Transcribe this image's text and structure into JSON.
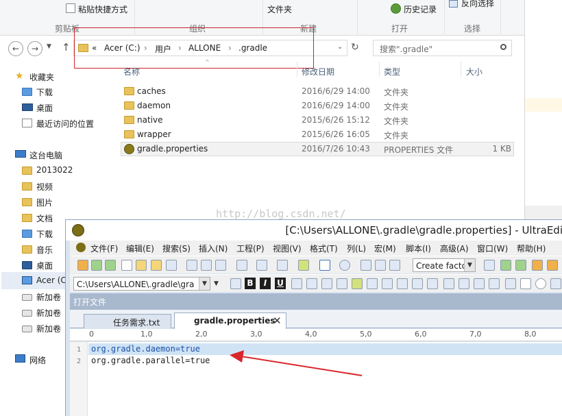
{
  "ribbon": {
    "top_items": {
      "paste_shortcut": "粘贴快捷方式",
      "file_folder": "文件夹",
      "history": "历史记录",
      "reverse_select": "反向选择"
    },
    "groups": [
      "剪贴板",
      "组织",
      "新建",
      "打开",
      "选择"
    ]
  },
  "address": {
    "overflow": "«",
    "segments": [
      "Acer (C:)",
      "用户",
      "ALLONE",
      ".gradle"
    ],
    "separator": "›"
  },
  "search": {
    "placeholder": "搜索\".gradle\""
  },
  "columns": {
    "name": "名称",
    "date": "修改日期",
    "type": "类型",
    "size": "大小"
  },
  "nav": {
    "favorites": "收藏夹",
    "fav_items": [
      "下载",
      "桌面",
      "最近访问的位置"
    ],
    "this_pc": "这台电脑",
    "pc_items": [
      "2013022",
      "视频",
      "图片",
      "文档",
      "下载",
      "音乐",
      "桌面",
      "Acer (C",
      "新加卷",
      "新加卷",
      "新加卷"
    ],
    "network": "网络"
  },
  "files": [
    {
      "name": "caches",
      "date": "2016/6/29 14:00",
      "type": "文件夹",
      "size": ""
    },
    {
      "name": "daemon",
      "date": "2016/6/29 14:00",
      "type": "文件夹",
      "size": ""
    },
    {
      "name": "native",
      "date": "2015/6/26 15:12",
      "type": "文件夹",
      "size": ""
    },
    {
      "name": "wrapper",
      "date": "2015/6/26 16:05",
      "type": "文件夹",
      "size": ""
    },
    {
      "name": "gradle.properties",
      "date": "2016/7/26 10:43",
      "type": "PROPERTIES 文件",
      "size": "1 KB"
    }
  ],
  "watermark": "http://blog.csdn.net/",
  "ultraedit": {
    "title": "[C:\\Users\\ALLONE\\.gradle\\gradle.properties] - UltraEdi",
    "menu": [
      "文件(F)",
      "编辑(E)",
      "搜索(S)",
      "插入(N)",
      "工程(P)",
      "视图(V)",
      "格式(T)",
      "列(L)",
      "宏(M)",
      "脚本(I)",
      "高级(A)",
      "窗口(W)",
      "帮助(H)"
    ],
    "create_combo": "Create facto",
    "path_combo": "C:\\Users\\ALLONE\\.gradle\\gra",
    "open_files_label": "打开文件",
    "tabs": [
      "任务需求.txt",
      "gradle.properties"
    ],
    "tab_close": "✕",
    "ruler": [
      "0",
      "1,0",
      "2,0",
      "3,0",
      "4,0",
      "5,0",
      "6,0",
      "7,0",
      "8,0"
    ],
    "lines": [
      {
        "number": "1",
        "text": "org.gradle.daemon=true"
      },
      {
        "number": "2",
        "text": "org.gradle.parallel=true"
      }
    ]
  },
  "colors": {
    "accent_red": "#d9262b",
    "line_highlight": "#cfe3f5",
    "code_blue": "#1a50a8"
  }
}
